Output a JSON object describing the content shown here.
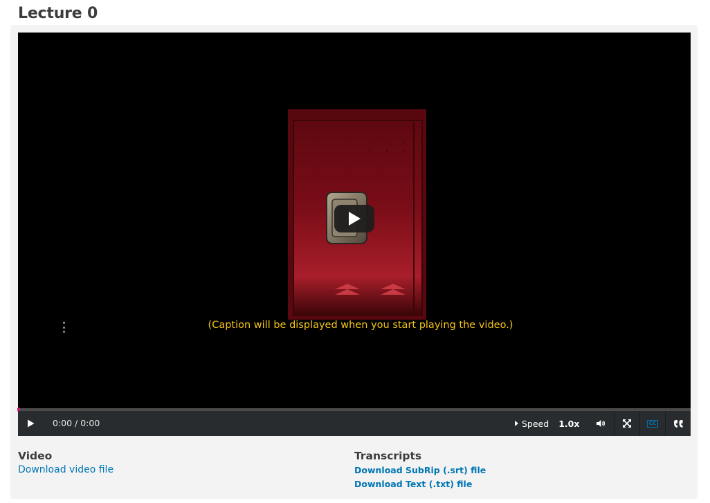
{
  "lecture": {
    "title": "Lecture 0"
  },
  "player": {
    "caption_placeholder": "(Caption will be displayed when you start playing the video.)",
    "time_display": "0:00 / 0:00",
    "progress_fraction": 0.0,
    "speed_label": "Speed",
    "speed_value": "1.0x",
    "icons": {
      "play_overlay": "play-icon",
      "play": "play-icon",
      "volume": "volume-icon",
      "fullscreen": "fullscreen-icon",
      "captions": "closed-captions-icon",
      "transcript": "quote-icon",
      "menu": "kebab-menu-icon"
    },
    "cc_icon_text": "CC",
    "colors": {
      "caption": "#f5c518",
      "progress": "#c51a6b",
      "controls_bg": "#282c2e",
      "accent": "#0075b4"
    }
  },
  "downloads": {
    "video_heading": "Video",
    "video_link": "Download video file",
    "transcripts_heading": "Transcripts",
    "transcript_links": [
      "Download SubRip (.srt) file",
      "Download Text (.txt) file"
    ]
  }
}
